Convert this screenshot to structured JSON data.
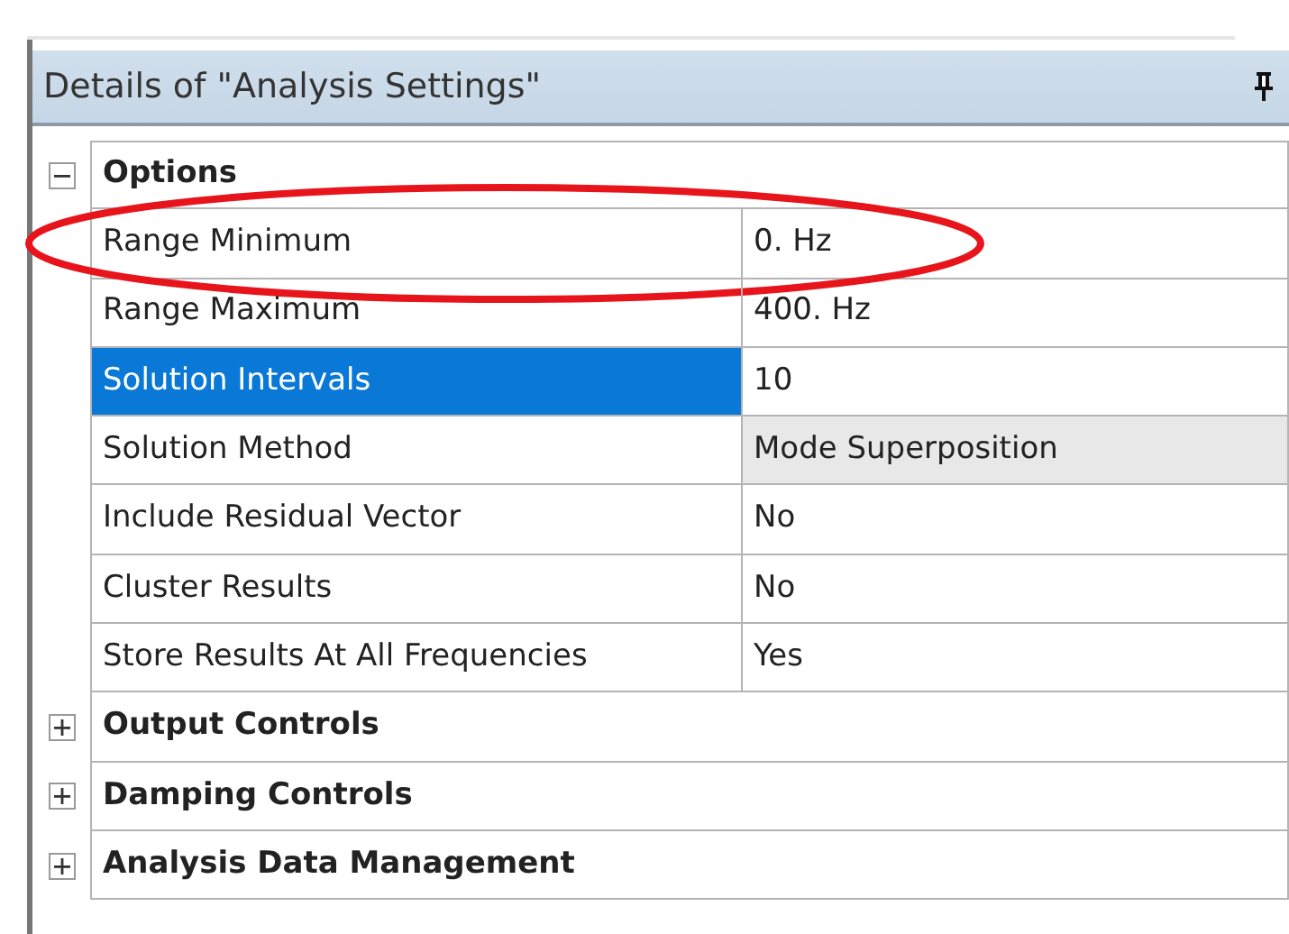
{
  "panel": {
    "title": "Details of \"Analysis Settings\""
  },
  "groups": [
    {
      "label": "Options",
      "expanded": true,
      "properties": [
        {
          "name": "Range Minimum",
          "value": "0. Hz",
          "kind": "text",
          "selected": false,
          "circled": true
        },
        {
          "name": "Range Maximum",
          "value": "400. Hz",
          "kind": "text",
          "selected": false
        },
        {
          "name": "Solution Intervals",
          "value": "10",
          "kind": "text",
          "selected": true
        },
        {
          "name": "Solution Method",
          "value": "Mode Superposition",
          "kind": "dropdown",
          "selected": false
        },
        {
          "name": "Include Residual Vector",
          "value": "No",
          "kind": "text",
          "selected": false
        },
        {
          "name": "Cluster Results",
          "value": "No",
          "kind": "text",
          "selected": false
        },
        {
          "name": "Store Results At All Frequencies",
          "value": "Yes",
          "kind": "text",
          "selected": false
        }
      ]
    },
    {
      "label": "Output Controls",
      "expanded": false
    },
    {
      "label": "Damping Controls",
      "expanded": false
    },
    {
      "label": "Analysis Data Management",
      "expanded": false
    }
  ]
}
